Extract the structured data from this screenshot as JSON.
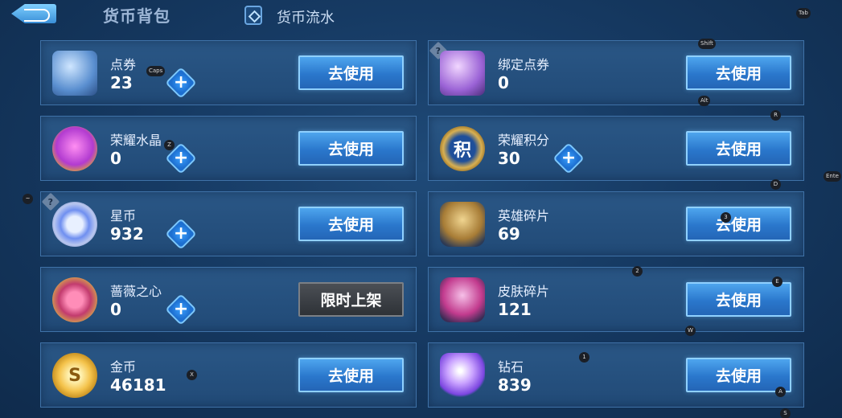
{
  "header": {
    "back_icon": "back-arrow-icon",
    "tab_wallet": "货币背包",
    "tab_flow": "货币流水",
    "tab_flow_icon": "currency-flow-icon"
  },
  "cards": [
    {
      "name": "点券",
      "value": "23",
      "icon": "ticket-icon",
      "action": "去使用",
      "has_plus": true
    },
    {
      "name": "绑定点券",
      "value": "0",
      "icon": "bound-ticket-icon",
      "action": "去使用",
      "has_plus": false,
      "help": "?"
    },
    {
      "name": "荣耀水晶",
      "value": "0",
      "icon": "glory-crystal-icon",
      "action": "去使用",
      "has_plus": true
    },
    {
      "name": "荣耀积分",
      "value": "30",
      "icon": "glory-points-icon",
      "action": "去使用",
      "has_plus": true,
      "icon_text": "积"
    },
    {
      "name": "星币",
      "value": "932",
      "icon": "star-coin-icon",
      "action": "去使用",
      "has_plus": true,
      "help": "?"
    },
    {
      "name": "英雄碎片",
      "value": "69",
      "icon": "hero-fragment-icon",
      "action": "去使用",
      "has_plus": false
    },
    {
      "name": "蔷薇之心",
      "value": "0",
      "icon": "rose-heart-icon",
      "action": "限时上架",
      "has_plus": true
    },
    {
      "name": "皮肤碎片",
      "value": "121",
      "icon": "skin-fragment-icon",
      "action": "去使用",
      "has_plus": false
    },
    {
      "name": "金币",
      "value": "46181",
      "icon": "gold-coin-icon",
      "action": "去使用",
      "has_plus": false,
      "icon_text": "S"
    },
    {
      "name": "钻石",
      "value": "839",
      "icon": "diamond-icon",
      "action": "去使用",
      "has_plus": false
    }
  ],
  "key_hints": [
    "Tab",
    "Shift",
    "Caps",
    "Alt",
    "R",
    "Z",
    "D",
    "Ente",
    "~",
    "3",
    "2",
    "E",
    "W",
    "1",
    "X",
    "A",
    "S"
  ]
}
